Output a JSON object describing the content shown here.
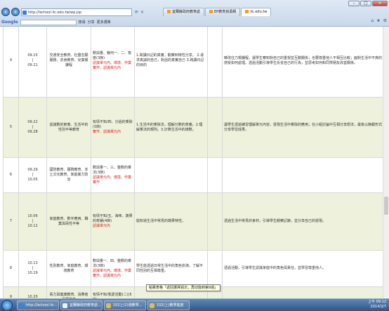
{
  "browser": {
    "address": "http://lschool.ilc.edu.tw/wp.jsp",
    "tabs": [
      "宜蘭縣政府教育處",
      "EP教育資源網",
      "ilc.edu.tw"
    ],
    "google_label": "Google",
    "search_label": "搜尋",
    "share_label": "分享",
    "more_label": "更多選單"
  },
  "rows": [
    {
      "num": "4",
      "date_start": "09.15",
      "date_sep": "|",
      "date_end": "09.21",
      "topic": "交通安全教育、社團志願服務、衣食教育、兒童權課程",
      "category": "",
      "cat_main": "數與量、幾何一、二、角度(3節)",
      "cat_red1": "認識單元內、環境、作業",
      "cat_red2": "實作、認識單元內",
      "activity": "1.跨讀日記的真實，觀察到特性分享。 2.尋求真誠的自己，對話的真實自己 3.跨讀日記的目的",
      "note": "韓改往力規課程，讓學生察知對自己的重視並互動關係；也要尊重他人不相互比較；面對生活中不爽的感受如何處理。透過活動引導學生反省自己的行為，並思考如何和同學朋友改善關係。"
    },
    {
      "num": "5",
      "date_start": "09.22",
      "date_sep": "|",
      "date_end": "09.28",
      "topic": "認識數的節奏、生活中的性別平等教育",
      "category": "",
      "cat_main": "有情不知/四、分過的乘除(5節)",
      "cat_red1": "實作、認識單元內",
      "cat_red2": "",
      "activity": "1.生活中的乘除法，理解分數的意義。2.理解乘法的規則。3.計算生活中的總數。",
      "note": "讓學生透過練習理解單元內容，發現生活中乘除的應用；在小組討論中互相分享想法，最後以簡報形式分享學習成果。"
    },
    {
      "num": "6",
      "date_start": "09.29",
      "date_sep": "|",
      "date_end": "10.05",
      "topic": "國防教育、服務教育、本土文化教育、家庭暴力防治",
      "category": "",
      "cat_main": "數與量一、三、整數的乘法(3節)",
      "cat_red1": "認識單元內、環境、作業",
      "cat_red2": "實作",
      "activity": "",
      "note": ""
    },
    {
      "num": "7",
      "date_start": "10.06",
      "date_sep": "|",
      "date_end": "10.12",
      "topic": "家庭教育、數字應用、職業與兩性平等",
      "category": "",
      "cat_main": "有情不知/五、海味、蔬果的奇蹟(4節)",
      "cat_red1": "認識單元內",
      "cat_red2": "",
      "activity": "能知道生活中常見的蔬果特性。",
      "note": "透過生活中常見的食材，引導學生觀察記錄，並分享自己的發現。"
    },
    {
      "num": "8",
      "date_start": "10.13",
      "date_sep": "|",
      "date_end": "10.19",
      "topic": "性別教育、家庭教育、環境教育",
      "category": "",
      "cat_main": "數與量一、四、整數的乘法(3節)",
      "cat_red1": "認識單元內、環境、作業",
      "cat_red2": "實作、認識單元內",
      "activity": "學生能透過日常生活中的角色扮演，了解不同性別的互相尊重。",
      "note": "透過活動，引導學生認識家庭中的角色與責任，並學習尊重他人。"
    },
    {
      "num": "9",
      "date_start": "10.20",
      "date_sep": "",
      "date_end": "",
      "topic": "兩力與健康教育、消費者保護教育",
      "category": "",
      "cat_main": "有情不知/我愛活動(二)(5節)",
      "cat_red1": "",
      "cat_red2": "",
      "activity": "",
      "note": ""
    }
  ],
  "tooltip": "點擊表格「返回選擇週次，再切換到第9週」",
  "taskbar": {
    "items": [
      "http://lschool.ilc...",
      "宜蘭縣政府教育處...",
      "102上(2)週教學...",
      "102(上)教學進度"
    ],
    "time": "上午 09:12",
    "date": "2014/3/7"
  },
  "colors": {
    "accent": "#3366cc",
    "red_text": "#e02020",
    "alt_row": "#eef2dc"
  }
}
